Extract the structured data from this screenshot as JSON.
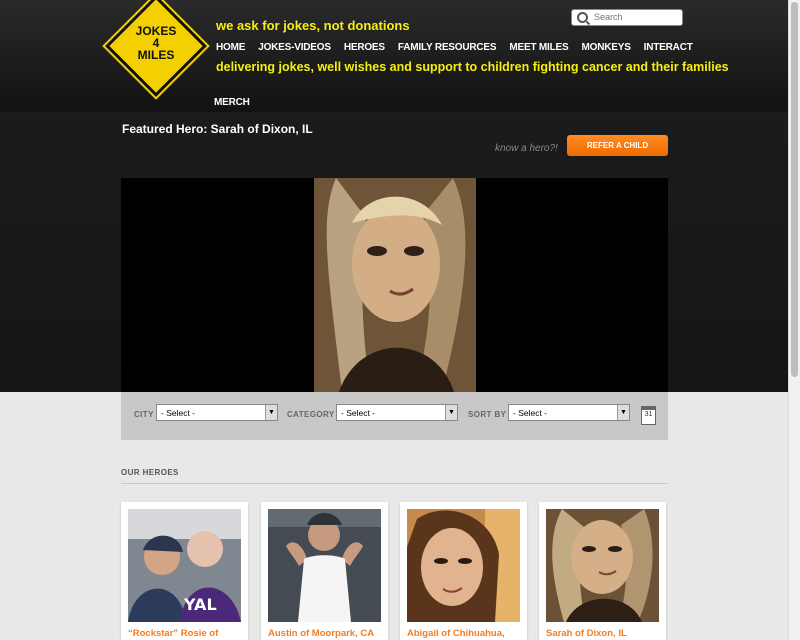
{
  "header": {
    "logo_text": "JOKES\n4\nMILES",
    "tagline": "we ask for jokes, not donations",
    "subline": "delivering jokes, well wishes and support to children fighting cancer and their families",
    "search_placeholder": "Search"
  },
  "nav": [
    "HOME",
    "JOKES-VIDEOS",
    "HEROES",
    "FAMILY RESOURCES",
    "MEET MILES",
    "MONKEYS",
    "INTERACT"
  ],
  "merch": "MERCH",
  "featured": {
    "title": "Featured Hero: Sarah of Dixon, IL",
    "know_hero": "know a hero?!",
    "refer_label": "REFER A CHILD"
  },
  "filters": {
    "city_label": "CITY",
    "city_value": "- Select -",
    "category_label": "CATEGORY",
    "category_value": "- Select -",
    "sort_label": "SORT BY",
    "sort_value": "- Select -",
    "calendar_icon": "31"
  },
  "heroes": {
    "heading": "OUR HEROES",
    "cards": [
      {
        "caption": "“Rockstar” Rosie of"
      },
      {
        "caption": "Austin of Moorpark, CA"
      },
      {
        "caption": "Abigail of Chihuahua,"
      },
      {
        "caption": "Sarah of Dixon, IL"
      }
    ]
  },
  "colors": {
    "accent_yellow": "#f6ee11",
    "accent_orange": "#f47c20",
    "header_dark": "#151515"
  }
}
